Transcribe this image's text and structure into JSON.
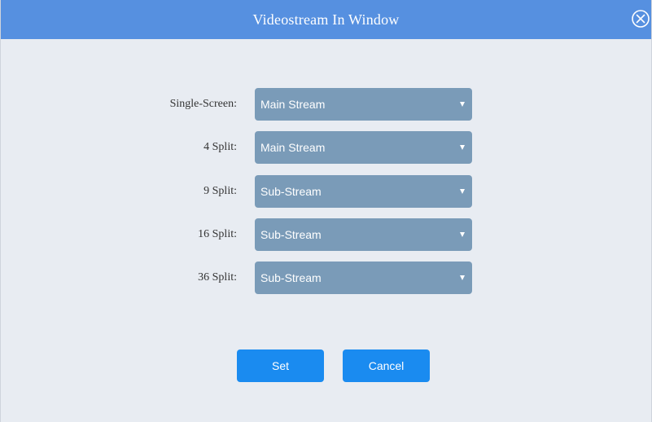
{
  "dialog": {
    "title": "Videostream In Window",
    "close_icon": "close-circle-x-icon"
  },
  "fields": [
    {
      "label": "Single-Screen:",
      "value": "Main Stream"
    },
    {
      "label": "4 Split:",
      "value": "Main Stream"
    },
    {
      "label": "9 Split:",
      "value": "Sub-Stream"
    },
    {
      "label": "16 Split:",
      "value": "Sub-Stream"
    },
    {
      "label": "36 Split:",
      "value": "Sub-Stream"
    }
  ],
  "buttons": {
    "set": "Set",
    "cancel": "Cancel"
  },
  "colors": {
    "titlebar": "#5690e0",
    "background": "#e8ecf2",
    "select": "#7a9bb8",
    "button": "#1a8bf0"
  }
}
